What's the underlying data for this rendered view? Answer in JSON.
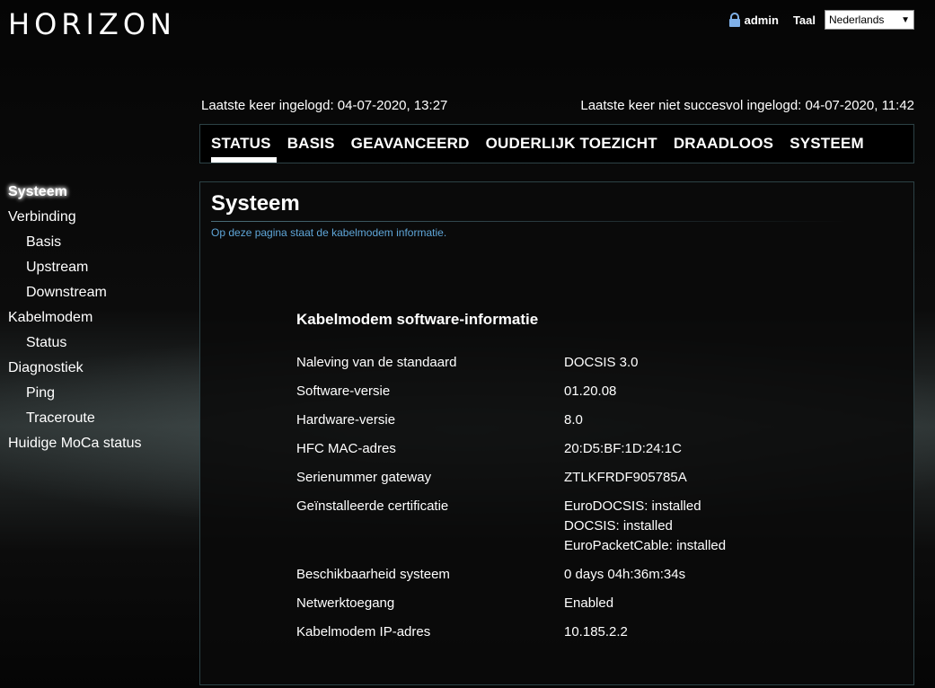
{
  "header": {
    "logo": "HORIZON",
    "user": "admin",
    "lang_label": "Taal",
    "lang_value": "Nederlands"
  },
  "login": {
    "last_login": "Laatste keer ingelogd: 04-07-2020, 13:27",
    "last_failed": "Laatste keer niet succesvol ingelogd: 04-07-2020, 11:42"
  },
  "nav": [
    "STATUS",
    "BASIS",
    "GEAVANCEERD",
    "OUDERLIJK TOEZICHT",
    "DRAADLOOS",
    "SYSTEEM"
  ],
  "sidebar": [
    {
      "label": "Systeem",
      "sub": false,
      "active": true
    },
    {
      "label": "Verbinding",
      "sub": false
    },
    {
      "label": "Basis",
      "sub": true
    },
    {
      "label": "Upstream",
      "sub": true
    },
    {
      "label": "Downstream",
      "sub": true
    },
    {
      "label": "Kabelmodem",
      "sub": false
    },
    {
      "label": "Status",
      "sub": true
    },
    {
      "label": "Diagnostiek",
      "sub": false
    },
    {
      "label": "Ping",
      "sub": true
    },
    {
      "label": "Traceroute",
      "sub": true
    },
    {
      "label": "Huidige MoCa status",
      "sub": false
    }
  ],
  "panel": {
    "title": "Systeem",
    "description": "Op deze pagina staat de kabelmodem informatie.",
    "section_title": "Kabelmodem software-informatie",
    "rows": [
      {
        "k": "Naleving van de standaard",
        "v": "DOCSIS 3.0"
      },
      {
        "k": "Software-versie",
        "v": "01.20.08"
      },
      {
        "k": "Hardware-versie",
        "v": "8.0"
      },
      {
        "k": "HFC MAC-adres",
        "v": "20:D5:BF:1D:24:1C"
      },
      {
        "k": "Serienummer gateway",
        "v": "ZTLKFRDF905785A"
      },
      {
        "k": "Geïnstalleerde certificatie",
        "v": "EuroDOCSIS: installed\nDOCSIS: installed\nEuroPacketCable: installed"
      },
      {
        "k": "Beschikbaarheid systeem",
        "v": "0 days 04h:36m:34s"
      },
      {
        "k": "Netwerktoegang",
        "v": "Enabled"
      },
      {
        "k": "Kabelmodem IP-adres",
        "v": "10.185.2.2"
      }
    ]
  },
  "colors": {
    "accent_link": "#5fa6d8",
    "border": "#2d4246"
  }
}
